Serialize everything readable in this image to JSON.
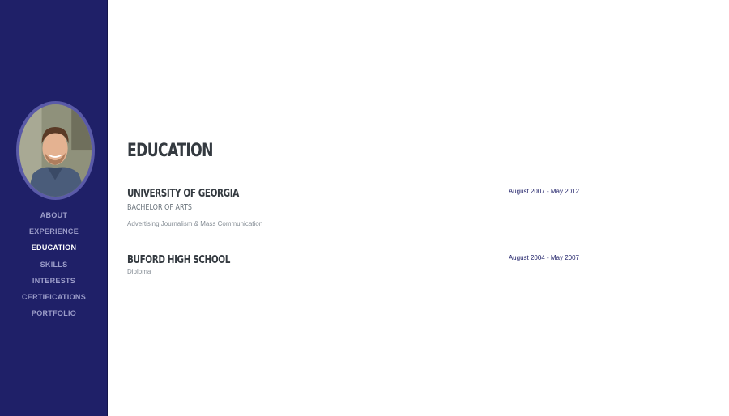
{
  "sidebar": {
    "nav": [
      {
        "label": "ABOUT",
        "active": false
      },
      {
        "label": "EXPERIENCE",
        "active": false
      },
      {
        "label": "EDUCATION",
        "active": true
      },
      {
        "label": "SKILLS",
        "active": false
      },
      {
        "label": "INTERESTS",
        "active": false
      },
      {
        "label": "CERTIFICATIONS",
        "active": false
      },
      {
        "label": "PORTFOLIO",
        "active": false
      }
    ]
  },
  "colors": {
    "sidebar_bg": "#1f2068",
    "avatar_border": "#5a5aa8",
    "nav_text": "#9c9dc9",
    "nav_active": "#ffffff",
    "heading": "#343a40",
    "date": "#1f2068"
  },
  "education": {
    "title": "EDUCATION",
    "entries": [
      {
        "school": "UNIVERSITY OF GEORGIA",
        "degree": "BACHELOR OF ARTS",
        "field": "Advertising Journalism & Mass Communication",
        "dates": "August 2007 - May 2012"
      },
      {
        "school": "BUFORD HIGH SCHOOL",
        "subtitle": "Diploma",
        "dates": "August 2004 - May 2007"
      }
    ]
  }
}
